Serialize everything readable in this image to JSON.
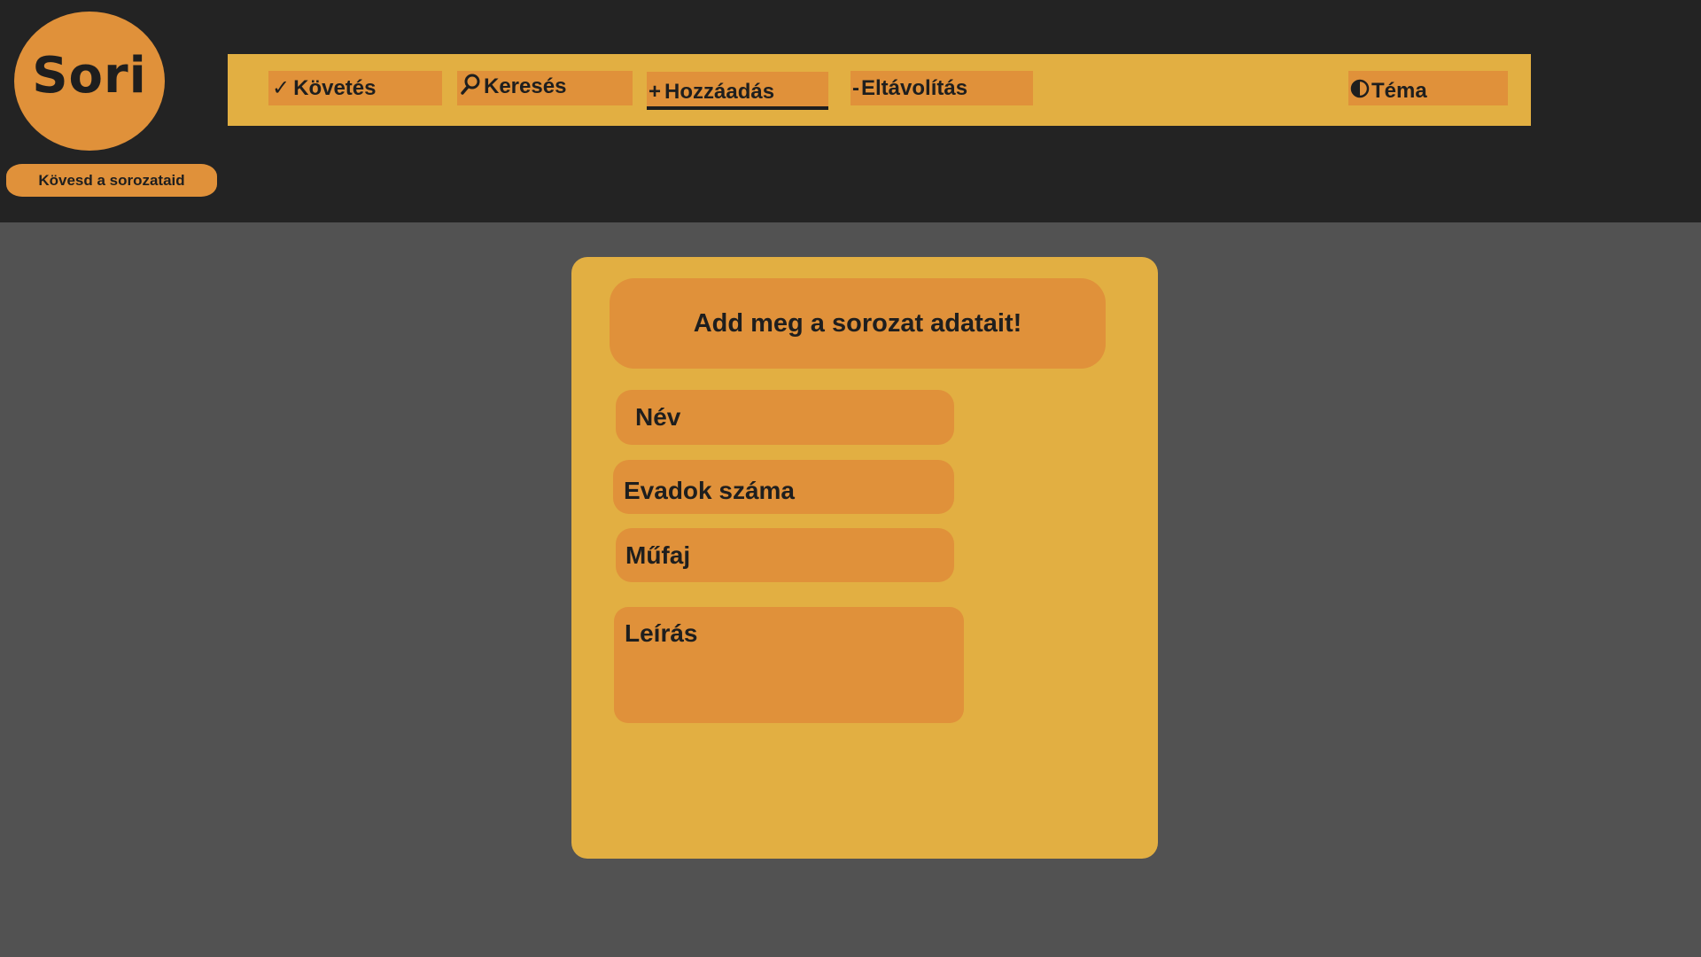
{
  "brand": {
    "logo_text": "Sori",
    "tagline": "Kövesd a sorozataid"
  },
  "nav": {
    "items": [
      {
        "icon": "✓",
        "icon_name": "checkmark-icon",
        "label": "Követés"
      },
      {
        "icon": "⚲",
        "icon_name": "search-icon",
        "label": "Keresés"
      },
      {
        "icon": "+",
        "icon_name": "plus-icon",
        "label": "Hozzáadás"
      },
      {
        "icon": "-",
        "icon_name": "minus-icon",
        "label": "Eltávolítás"
      },
      {
        "icon": "◐",
        "icon_name": "theme-contrast-icon",
        "label": "Téma"
      }
    ],
    "active_label": "Hozzáadás"
  },
  "form": {
    "title": "Add meg a sorozat adatait!",
    "fields": {
      "name": "Név",
      "seasons": "Evadok száma",
      "genre": "Műfaj",
      "description": "Leírás"
    }
  },
  "colors": {
    "header_bg": "#232323",
    "page_bg": "#525252",
    "panel_yellow": "#E2AF42",
    "accent_orange": "#E0913A",
    "text_dark": "#1e1e1e"
  }
}
